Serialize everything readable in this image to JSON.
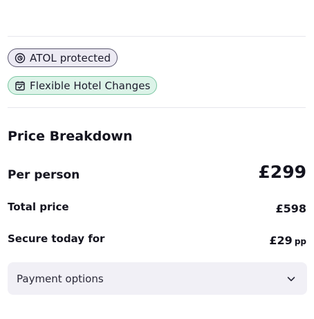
{
  "badges": {
    "atol": {
      "label": "ATOL protected",
      "icon": "atol-shield-icon"
    },
    "flexible": {
      "label": "Flexible Hotel Changes",
      "icon": "calendar-check-icon"
    }
  },
  "price_breakdown": {
    "title": "Price Breakdown",
    "per_person": {
      "label": "Per person",
      "value": "£299"
    },
    "total": {
      "label": "Total price",
      "value": "£598"
    },
    "secure": {
      "label": "Secure today for",
      "value": "£29",
      "suffix": "pp"
    }
  },
  "payment_options": {
    "label": "Payment options",
    "icon": "chevron-down-icon"
  },
  "colors": {
    "atol_badge_bg": "#eceaf3",
    "flex_badge_bg": "#dcf3e8",
    "flex_badge_border": "#7cc7a3",
    "payment_bg": "#f1f0f6",
    "text": "#14141f"
  }
}
